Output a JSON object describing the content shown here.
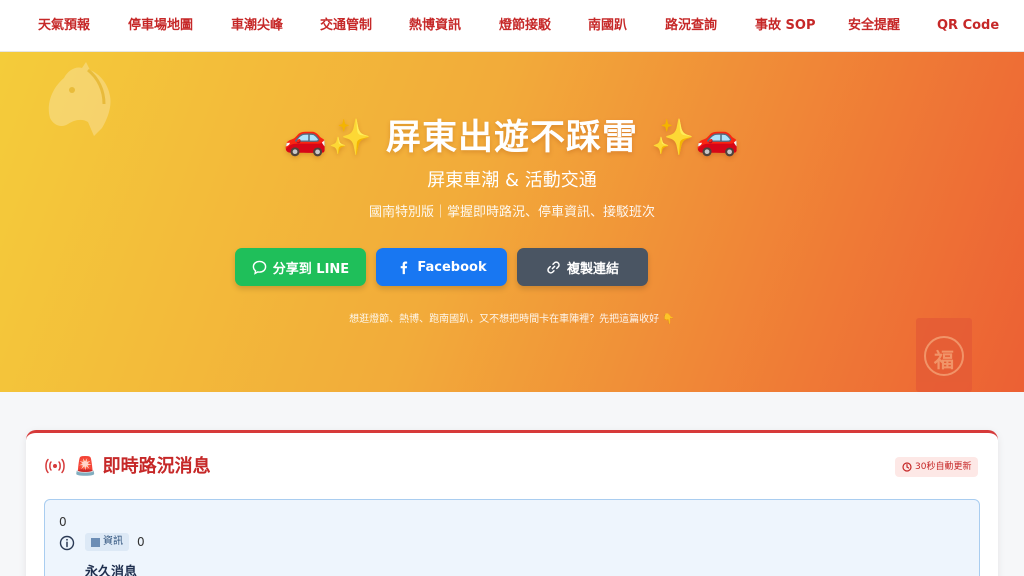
{
  "nav": {
    "items": [
      "天氣預報",
      "停車場地圖",
      "車潮尖峰",
      "交通管制",
      "熱博資訊",
      "燈節接駁",
      "南國趴",
      "路況查詢",
      "事故 SOP",
      "安全提醒",
      "QR Code"
    ]
  },
  "hero": {
    "title": "🚗✨ 屏東出遊不踩雷 ✨🚗",
    "subtitle": "屏東車潮 & 活動交通",
    "tagline": "國南特別版｜掌握即時路況、停車資訊、接駁班次",
    "note": "想逛燈節、熱博、跑南國趴，又不想把時間卡在車陣裡？先把這篇收好 👇",
    "buttons": {
      "line": "分享到 LINE",
      "facebook": "Facebook",
      "copy": "複製連結"
    },
    "decor": {
      "fu_char": "福"
    }
  },
  "traffic": {
    "title": "🚨 即時路況消息",
    "auto_refresh": "30秒自動更新",
    "message": {
      "count": "0",
      "badge": "資訊",
      "badge_count": "0",
      "title": "永久消息"
    }
  },
  "colors": {
    "accent_red": "#c62828",
    "line_green": "#1fbf5a",
    "facebook_blue": "#1877f2",
    "copy_gray": "#4a5563"
  }
}
